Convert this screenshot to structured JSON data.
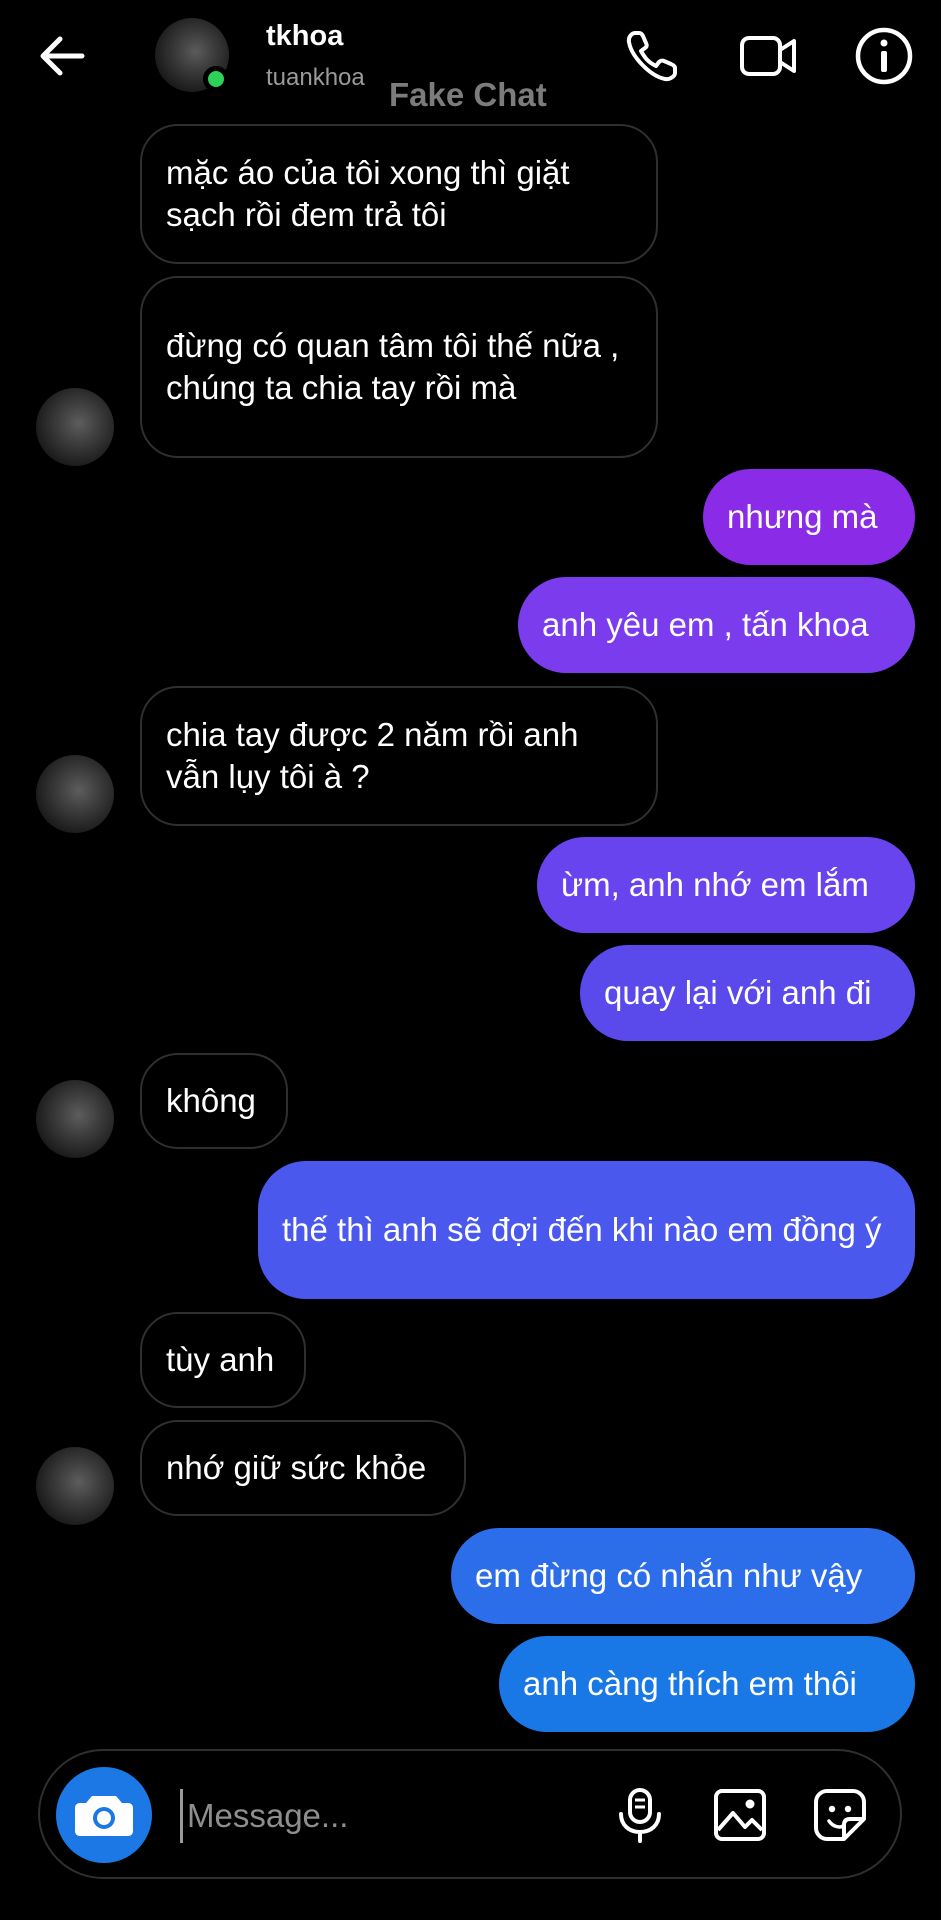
{
  "header": {
    "name": "tkhoa",
    "handle": "tuankhoa",
    "watermark": "Fake Chat",
    "online": true
  },
  "messages": [
    {
      "from": "them",
      "text": "mặc áo của tôi xong thì giặt sạch rồi đem trả tôi"
    },
    {
      "from": "them",
      "text": "đừng có quan tâm tôi thế nữa , chúng ta chia tay rồi mà"
    },
    {
      "from": "me",
      "text": "nhưng mà"
    },
    {
      "from": "me",
      "text": "anh yêu em , tấn khoa"
    },
    {
      "from": "them",
      "text": "chia tay được 2 năm rồi anh vẫn lụy tôi à ?"
    },
    {
      "from": "me",
      "text": "ừm, anh nhớ em lắm"
    },
    {
      "from": "me",
      "text": "quay lại với anh đi"
    },
    {
      "from": "them",
      "text": "không"
    },
    {
      "from": "me",
      "text": "thế thì anh sẽ đợi đến khi nào em đồng ý"
    },
    {
      "from": "them",
      "text": "tùy anh"
    },
    {
      "from": "them",
      "text": "nhớ giữ sức khỏe"
    },
    {
      "from": "me",
      "text": "em đừng có nhắn như vậy"
    },
    {
      "from": "me",
      "text": "anh càng thích em thôi"
    }
  ],
  "composer": {
    "placeholder": "Message...",
    "icons": [
      "camera-icon",
      "microphone-icon",
      "gallery-icon",
      "sticker-icon"
    ]
  },
  "colors": {
    "background": "#000000",
    "incoming_border": "#2f2f2f",
    "online_dot": "#2ed159",
    "camera_button": "#1b78e5",
    "outgoing_gradient": [
      "#8a2be8",
      "#7a3ced",
      "#6844ee",
      "#5b4aeb",
      "#4b58ee",
      "#2c6de9",
      "#1a78e6"
    ]
  }
}
